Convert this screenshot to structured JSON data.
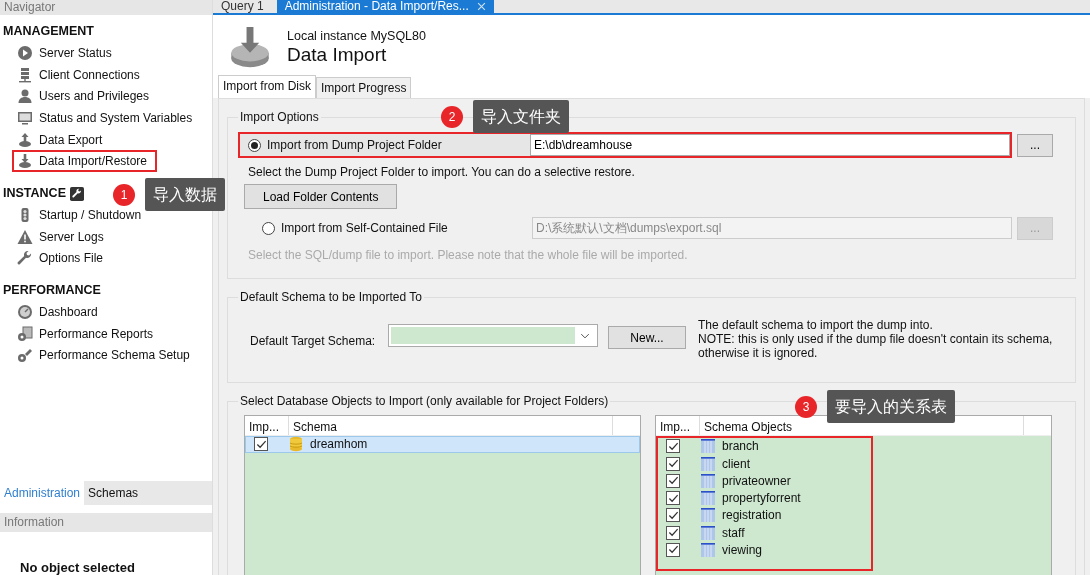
{
  "navigator": {
    "title": "Navigator",
    "sections": [
      {
        "title": "MANAGEMENT",
        "items": [
          {
            "label": "Server Status",
            "selected": false
          },
          {
            "label": "Client Connections",
            "selected": false
          },
          {
            "label": "Users and Privileges",
            "selected": false
          },
          {
            "label": "Status and System Variables",
            "selected": false
          },
          {
            "label": "Data Export",
            "selected": false
          },
          {
            "label": "Data Import/Restore",
            "selected": true
          }
        ]
      },
      {
        "title": "INSTANCE",
        "items": [
          {
            "label": "Startup / Shutdown",
            "selected": false
          },
          {
            "label": "Server Logs",
            "selected": false
          },
          {
            "label": "Options File",
            "selected": false
          }
        ]
      },
      {
        "title": "PERFORMANCE",
        "items": [
          {
            "label": "Dashboard",
            "selected": false
          },
          {
            "label": "Performance Reports",
            "selected": false
          },
          {
            "label": "Performance Schema Setup",
            "selected": false
          }
        ]
      }
    ]
  },
  "sidebar_tabs": [
    {
      "label": "Administration",
      "selected": true
    },
    {
      "label": "Schemas",
      "selected": false
    }
  ],
  "information": {
    "title": "Information",
    "message": "No object selected"
  },
  "editor_tabs": [
    {
      "label": "Query 1",
      "selected": false
    },
    {
      "label": "Administration - Data Import/Res...",
      "selected": true
    }
  ],
  "header": {
    "subtitle": "Local instance MySQL80",
    "title": "Data Import"
  },
  "page_tabs": [
    {
      "label": "Import from Disk",
      "selected": true
    },
    {
      "label": "Import Progress",
      "selected": false
    }
  ],
  "import_options": {
    "title": "Import Options",
    "options": [
      {
        "label": "Import from Dump Project Folder",
        "selected": true,
        "path": "E:\\db\\dreamhouse",
        "browse": "...",
        "hint": "Select the Dump Project Folder to import. You can do a selective restore.",
        "action": "Load Folder Contents"
      },
      {
        "label": "Import from Self-Contained File",
        "selected": false,
        "path": "D:\\系统默认\\文档\\dumps\\export.sql",
        "browse": "...",
        "hint": "Select the SQL/dump file to import. Please note that the whole file will be imported."
      }
    ]
  },
  "default_schema": {
    "title": "Default Schema to be Imported To",
    "label": "Default Target Schema:",
    "button": "New...",
    "note": [
      "The default schema to import the dump into.",
      "NOTE: this is only used if the dump file doesn't contain its schema,",
      "otherwise it is ignored."
    ]
  },
  "objects": {
    "title": "Select Database Objects to Import (only available for Project Folders)",
    "schemas": {
      "columns": [
        "Imp...",
        "Schema"
      ],
      "rows": [
        {
          "checked": true,
          "name": "dreamhom",
          "selected": true
        }
      ]
    },
    "tables": {
      "columns": [
        "Imp...",
        "Schema Objects"
      ],
      "rows": [
        {
          "checked": true,
          "name": "branch"
        },
        {
          "checked": true,
          "name": "client"
        },
        {
          "checked": true,
          "name": "privateowner"
        },
        {
          "checked": true,
          "name": "propertyforrent"
        },
        {
          "checked": true,
          "name": "registration"
        },
        {
          "checked": true,
          "name": "staff"
        },
        {
          "checked": true,
          "name": "viewing"
        }
      ]
    }
  },
  "annotations": [
    {
      "number": "1",
      "text": "导入数据"
    },
    {
      "number": "2",
      "text": "导入文件夹"
    },
    {
      "number": "3",
      "text": "要导入的关系表"
    }
  ]
}
